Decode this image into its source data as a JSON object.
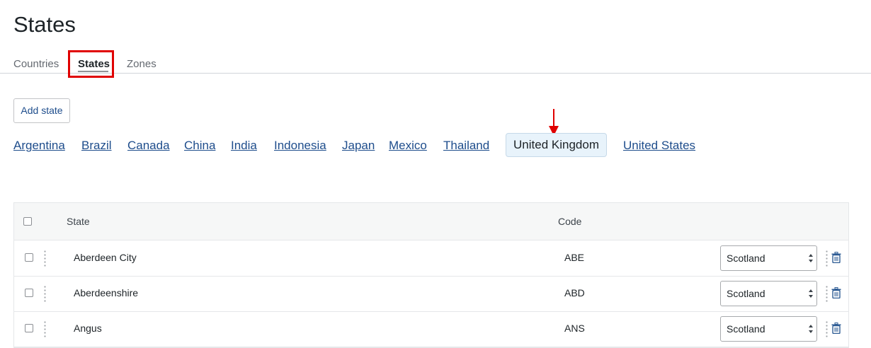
{
  "page": {
    "title": "States"
  },
  "tabs": [
    {
      "label": "Countries",
      "active": false
    },
    {
      "label": "States",
      "active": true
    },
    {
      "label": "Zones",
      "active": false
    }
  ],
  "actions": {
    "add_state": "Add state"
  },
  "countries": [
    {
      "label": "Argentina",
      "active": false
    },
    {
      "label": "Brazil",
      "active": false
    },
    {
      "label": "Canada",
      "active": false
    },
    {
      "label": "China",
      "active": false
    },
    {
      "label": "India",
      "active": false
    },
    {
      "label": "Indonesia",
      "active": false
    },
    {
      "label": "Japan",
      "active": false
    },
    {
      "label": "Mexico",
      "active": false
    },
    {
      "label": "Thailand",
      "active": false
    },
    {
      "label": "United Kingdom",
      "active": true
    },
    {
      "label": "United States",
      "active": false
    }
  ],
  "table": {
    "columns": [
      "State",
      "Code"
    ],
    "rows": [
      {
        "state": "Aberdeen City",
        "code": "ABE",
        "zone": "Scotland"
      },
      {
        "state": "Aberdeenshire",
        "code": "ABD",
        "zone": "Scotland"
      },
      {
        "state": "Angus",
        "code": "ANS",
        "zone": "Scotland"
      }
    ]
  },
  "colors": {
    "link": "#1e4d8c",
    "highlight_annotation": "#e00000",
    "active_country_bg": "#e8f3fb"
  },
  "icons": [
    "drag-handle-icon",
    "trash-icon",
    "select-caret-icon",
    "down-arrow-annotation-icon"
  ]
}
